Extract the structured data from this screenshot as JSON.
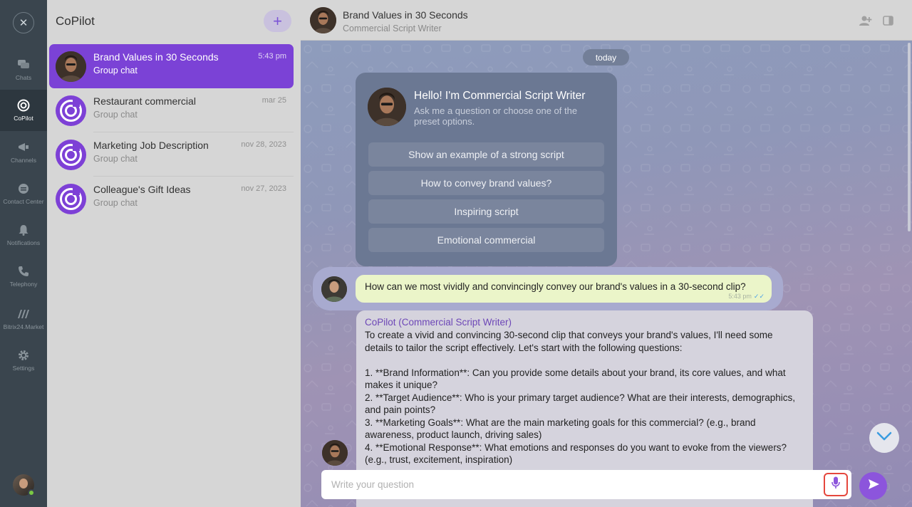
{
  "rail": {
    "items": [
      {
        "label": "Chats",
        "icon": "chats-icon"
      },
      {
        "label": "CoPilot",
        "icon": "copilot-icon"
      },
      {
        "label": "Channels",
        "icon": "megaphone-icon"
      },
      {
        "label": "Contact Center",
        "icon": "contact-center-icon"
      },
      {
        "label": "Notifications",
        "icon": "bell-icon"
      },
      {
        "label": "Telephony",
        "icon": "phone-icon"
      },
      {
        "label": "Bitrix24.Market",
        "icon": "market-icon"
      },
      {
        "label": "Settings",
        "icon": "gear-icon"
      }
    ],
    "active": "CoPilot"
  },
  "list": {
    "title": "CoPilot",
    "add_label": "+",
    "chats": [
      {
        "name": "Brand Values in 30 Seconds",
        "subtitle": "Group chat",
        "time": "5:43 pm",
        "active": true
      },
      {
        "name": "Restaurant commercial",
        "subtitle": "Group chat",
        "time": "mar 25",
        "active": false
      },
      {
        "name": "Marketing Job Description",
        "subtitle": "Group chat",
        "time": "nov 28, 2023",
        "active": false
      },
      {
        "name": "Colleague's Gift Ideas",
        "subtitle": "Group chat",
        "time": "nov 27, 2023",
        "active": false
      }
    ]
  },
  "header": {
    "title": "Brand Values in 30 Seconds",
    "subtitle": "Commercial Script Writer"
  },
  "chat": {
    "date_label": "today",
    "welcome": {
      "title": "Hello! I'm Commercial Script Writer",
      "subtitle": "Ask me a question or choose one of the preset options.",
      "presets": [
        "Show an example of a strong script",
        "How to convey brand values?",
        "Inspiring script",
        "Emotional commercial"
      ]
    },
    "user_message": {
      "text": "How can we most vividly and convincingly convey our brand's values in a 30-second clip?",
      "time": "5:43 pm",
      "check": "✓✓"
    },
    "bot_message": {
      "author": "CoPilot (Commercial Script Writer)",
      "text": "To create a vivid and convincing 30-second clip that conveys your brand's values, I'll need some details to tailor the script effectively. Let's start with the following questions:\n\n1. **Brand Information**: Can you provide some details about your brand, its core values, and what makes it unique?\n2. **Target Audience**: Who is your primary target audience? What are their interests, demographics, and pain points?\n3. **Marketing Goals**: What are the main marketing goals for this commercial? (e.g., brand awareness, product launch, driving sales)\n4. **Emotional Response**: What emotions and responses do you want to evoke from the viewers? (e.g., trust, excitement, inspiration)"
    },
    "input_placeholder": "Write your question"
  },
  "colors": {
    "accent": "#7b42d6",
    "send": "#8c55dc",
    "mic_highlight": "#e5473d",
    "user_bubble": "#ebf5c9"
  }
}
